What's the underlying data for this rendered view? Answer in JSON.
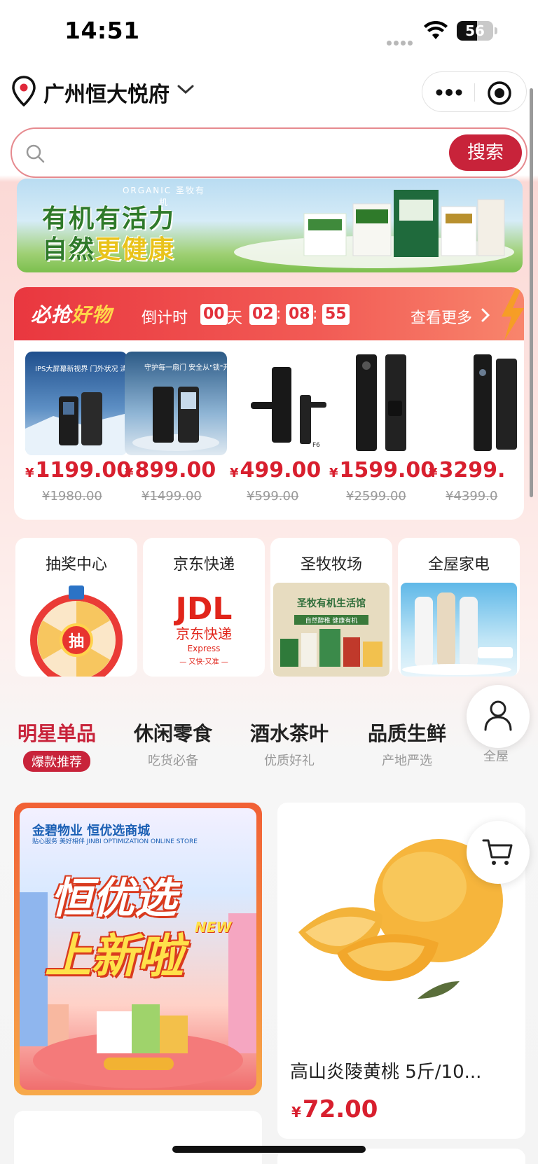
{
  "status_bar": {
    "time": "14:51",
    "battery": "56"
  },
  "header": {
    "location": "广州恒大悦府"
  },
  "search": {
    "placeholder": "",
    "button": "搜索"
  },
  "hero": {
    "brand": "ORGANIC 圣牧有机",
    "line1": "有机有活力",
    "line2_prefix": "自然",
    "line2_accent": "更健康"
  },
  "flash_sale": {
    "title_a": "必抢",
    "title_b": "好物",
    "countdown_label": "倒计时",
    "days": "00",
    "day_unit": "天",
    "hours": "02",
    "minutes": "08",
    "seconds": "55",
    "sep": ":",
    "view_more": "查看更多",
    "currency": "¥",
    "items": [
      {
        "price": "1199.00",
        "original": "¥1980.00",
        "img_caption": "IPS大屏幕新视界 门外状况 清晰可见"
      },
      {
        "price": "899.00",
        "original": "¥1499.00",
        "img_caption": "守护每一扇门 安全从\"锁\"开始"
      },
      {
        "price": "499.00",
        "original": "¥599.00",
        "img_caption": "F6"
      },
      {
        "price": "1599.00",
        "original": "¥2599.00",
        "img_caption": ""
      },
      {
        "price": "3299.",
        "original": "¥4399.0",
        "img_caption": ""
      }
    ]
  },
  "tiles": [
    {
      "title": "抽奖中心",
      "glyph": "抽"
    },
    {
      "title": "京东快递",
      "logo": "JDL",
      "sub": "京东快递",
      "sub2": "Express",
      "sub3": "— 又快·又准 —"
    },
    {
      "title": "圣牧牧场",
      "caption": "圣牧有机生活馆",
      "caption2": "自然醇稚 健康有机"
    },
    {
      "title": "全屋家电"
    }
  ],
  "categories": [
    {
      "main": "明星单品",
      "sub": "爆款推荐",
      "active": true
    },
    {
      "main": "休闲零食",
      "sub": "吃货必备"
    },
    {
      "main": "酒水茶叶",
      "sub": "优质好礼"
    },
    {
      "main": "品质生鲜",
      "sub": "产地严选"
    },
    {
      "main": "",
      "sub": "全屋"
    }
  ],
  "promo": {
    "brand": "金碧物业  恒优选商城",
    "sub": "贴心服务  美好相伴     JINBI OPTIMIZATION ONLINE STORE",
    "line1": "恒优选",
    "line2": "上新啦",
    "new_tag": "NEW"
  },
  "product": {
    "name": "高山炎陵黄桃 5斤/10...",
    "currency": "¥",
    "price": "72.00"
  },
  "colors": {
    "brand_red": "#c8233a",
    "price_red": "#d81f2e"
  },
  "icons": [
    "location-pin-icon",
    "chevron-down-icon",
    "more-icon",
    "target-icon",
    "search-icon",
    "chevron-right-icon",
    "user-icon",
    "cart-icon",
    "wifi-icon",
    "battery-icon"
  ]
}
